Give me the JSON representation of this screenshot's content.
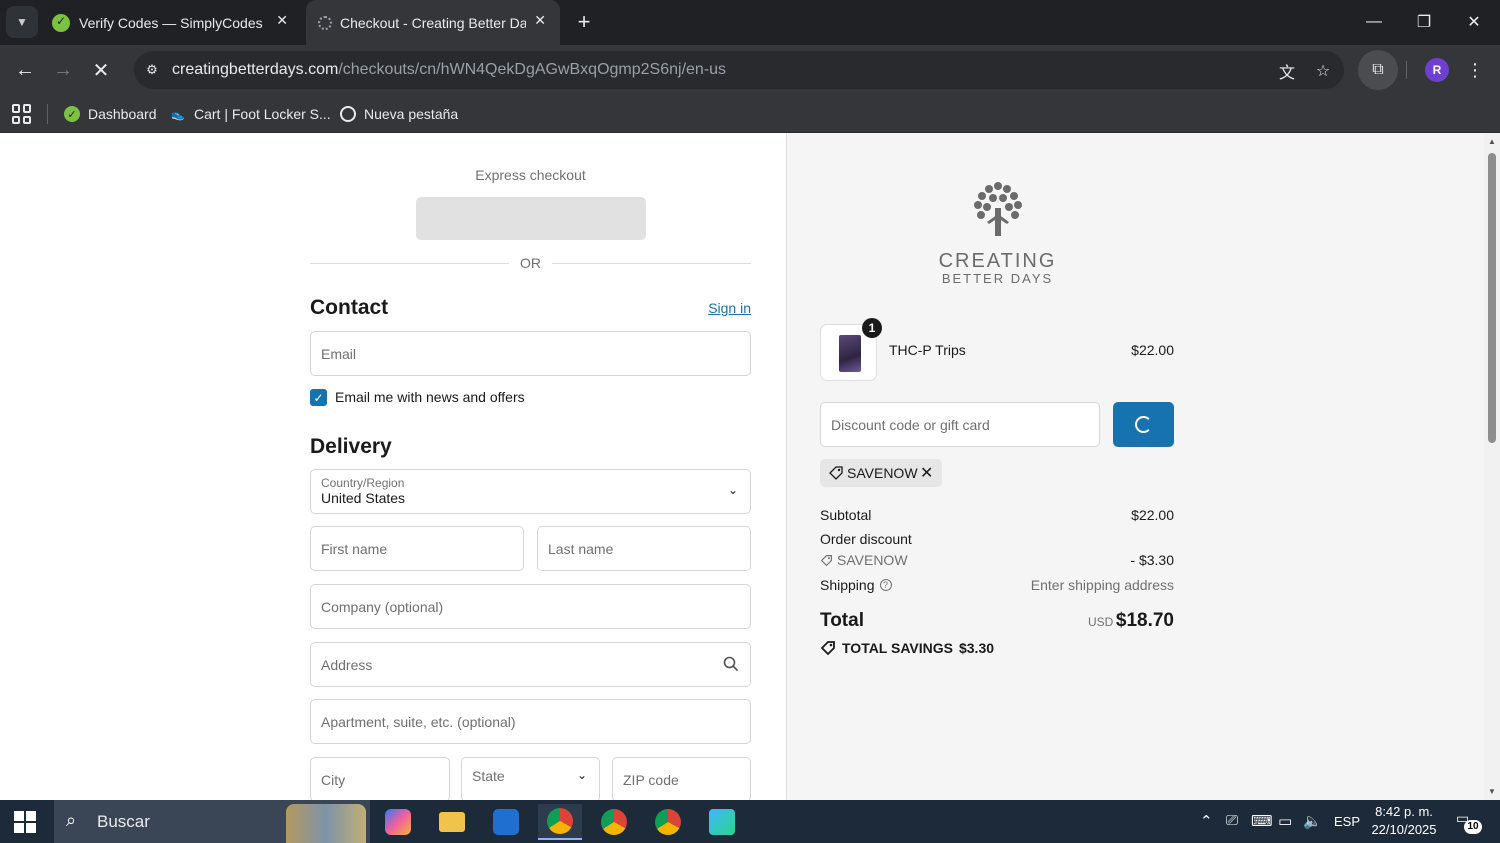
{
  "browser": {
    "tabs": [
      {
        "title": "Verify Codes — SimplyCodes",
        "active": false
      },
      {
        "title": "Checkout - Creating Better Days",
        "active": true
      }
    ],
    "url_host": "creatingbetterdays.com",
    "url_path": "/checkouts/cn/hWN4QekDgAGwBxqOgmp2S6nj/en-us",
    "profile_initial": "R",
    "bookmarks": [
      {
        "label": "Dashboard"
      },
      {
        "label": "Cart | Foot Locker S..."
      },
      {
        "label": "Nueva pestaña"
      }
    ]
  },
  "checkout": {
    "express_checkout_label": "Express checkout",
    "or_label": "OR",
    "contact": {
      "title": "Contact",
      "sign_in_label": "Sign in",
      "email_placeholder": "Email",
      "newsletter_label": "Email me with news and offers",
      "newsletter_checked": true
    },
    "delivery": {
      "title": "Delivery",
      "country_label": "Country/Region",
      "country_value": "United States",
      "first_name_placeholder": "First name",
      "last_name_placeholder": "Last name",
      "company_placeholder": "Company (optional)",
      "address_placeholder": "Address",
      "apartment_placeholder": "Apartment, suite, etc. (optional)",
      "city_placeholder": "City",
      "state_placeholder": "State",
      "zip_placeholder": "ZIP code"
    }
  },
  "order_summary": {
    "brand_name": "CREATING",
    "brand_sub": "BETTER DAYS",
    "product": {
      "name": "THC-P Trips",
      "price": "$22.00",
      "quantity": "1"
    },
    "discount_placeholder": "Discount code or gift card",
    "applied_code": "SAVENOW",
    "subtotal_label": "Subtotal",
    "subtotal_value": "$22.00",
    "order_discount_label": "Order discount",
    "discount_code": "SAVENOW",
    "discount_value": "- $3.30",
    "shipping_label": "Shipping",
    "shipping_value": "Enter shipping address",
    "total_label": "Total",
    "total_currency": "USD",
    "total_value": "$18.70",
    "total_savings_label": "TOTAL SAVINGS",
    "total_savings_value": "$3.30",
    "accent_color": "#1773b0"
  },
  "taskbar": {
    "search_label": "Buscar",
    "language": "ESP",
    "time": "8:42 p. m.",
    "date": "22/10/2025",
    "notification_count": "10"
  }
}
